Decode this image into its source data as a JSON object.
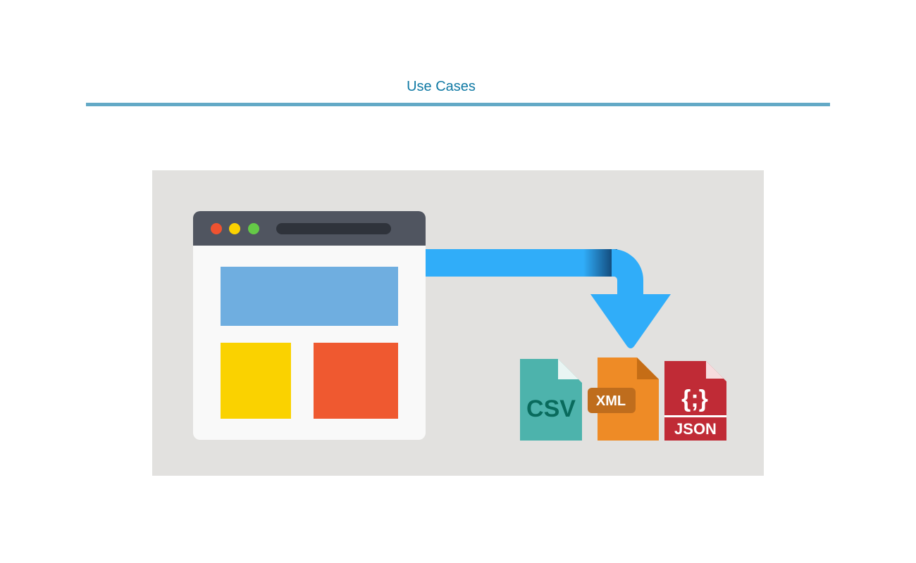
{
  "page": {
    "heading": "Use Cases"
  },
  "illustration": {
    "browser": {
      "dots": [
        "#ef5230",
        "#fad200",
        "#65c947"
      ],
      "chrome_color": "#505560",
      "banner_color": "#6faee0",
      "tile_colors": [
        "#fad200",
        "#ef5930"
      ]
    },
    "arrow_color": "#30adf9",
    "files": [
      {
        "label": "CSV",
        "color": "#4db3ac",
        "text_color": "#096b5d"
      },
      {
        "label": "XML",
        "color": "#ee8b26",
        "text_color": "#ffffff"
      },
      {
        "label": "JSON",
        "brace": "{;}",
        "color": "#c02b36",
        "text_color": "#ffffff"
      }
    ]
  }
}
